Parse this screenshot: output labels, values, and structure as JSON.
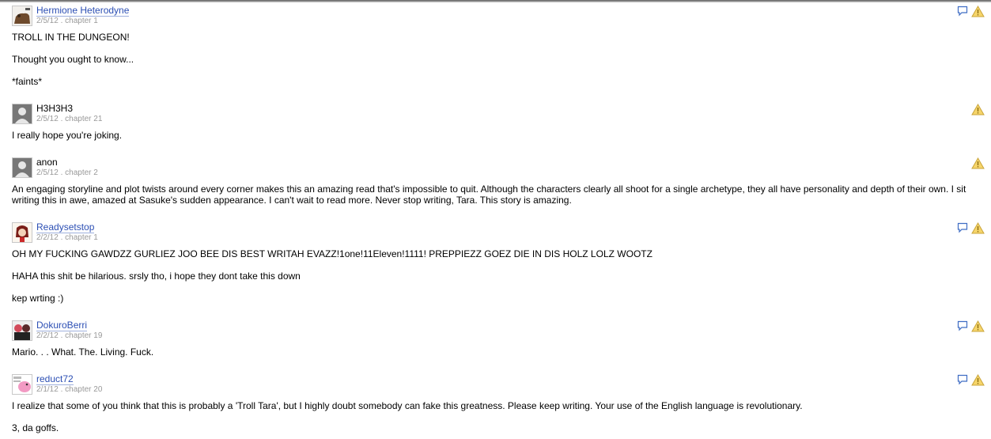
{
  "reviews": [
    {
      "author": "Hermione Heterodyne",
      "date": "2/5/12",
      "chapter": "chapter 1",
      "body": [
        "TROLL IN THE DUNGEON!",
        "Thought you ought to know...",
        "*faints*"
      ]
    },
    {
      "author": "H3H3H3",
      "date": "2/5/12",
      "chapter": "chapter 21",
      "body": [
        "I really hope you're joking."
      ]
    },
    {
      "author": "anon",
      "date": "2/5/12",
      "chapter": "chapter 2",
      "body": [
        "An engaging storyline and plot twists around every corner makes this an amazing read that's impossible to quit. Although the characters clearly all shoot for a single archetype, they all have personality and depth of their own. I sit writing this in awe, amazed at Sasuke's sudden appearance. I can't wait to read more. Never stop writing, Tara. This story is amazing."
      ]
    },
    {
      "author": "Readysetstop",
      "date": "2/2/12",
      "chapter": "chapter 1",
      "body": [
        "OH MY FUCKING GAWDZZ GURLIEZ JOO BEE DIS BEST WRITAH EVAZZ!1one!11Eleven!1111! PREPPIEZZ GOEZ DIE IN DIS HOLZ LOLZ WOOTZ",
        "HAHA this shit be hilarious. srsly tho, i hope they dont take this down",
        "kep wrting :)"
      ]
    },
    {
      "author": "DokuroBerri",
      "date": "2/2/12",
      "chapter": "chapter 19",
      "body": [
        "Mario. . . What. The. Living. Fuck."
      ]
    },
    {
      "author": "reduct72",
      "date": "2/1/12",
      "chapter": "chapter 20",
      "body": [
        "I realize that some of you think that this is probably a 'Troll Tara', but I highly doubt somebody can fake this greatness. Please keep writing. Your use of the English language is revolutionary.",
        "3, da goffs."
      ]
    }
  ],
  "meta_separator": " . ",
  "colors": {
    "link": "#2c4fb4",
    "meta": "#999999",
    "warning": "#f3c84a"
  },
  "icons": {
    "reply": "speech-bubble-icon",
    "report": "warning-triangle-icon"
  }
}
